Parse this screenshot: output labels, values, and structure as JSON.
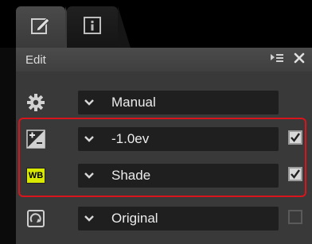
{
  "header": {
    "title": "Edit"
  },
  "icons": {
    "tab_edit": "edit-pencil-icon",
    "tab_info": "info-icon",
    "menu": "menu-expand-icon",
    "close": "close-icon",
    "settings": "gear-icon",
    "exposure": "exposure-compensation-icon",
    "wb": "white-balance-icon",
    "picture_control": "picture-control-icon"
  },
  "rows": [
    {
      "value": "Manual",
      "checkbox": null
    },
    {
      "value": "-1.0ev",
      "checkbox": "checked"
    },
    {
      "value": "Shade",
      "checkbox": "checked"
    },
    {
      "value": "Original",
      "checkbox": "unchecked"
    }
  ],
  "wb_badge": "WB",
  "colors": {
    "highlight": "#d8141c",
    "wb_badge": "#d9e800"
  }
}
